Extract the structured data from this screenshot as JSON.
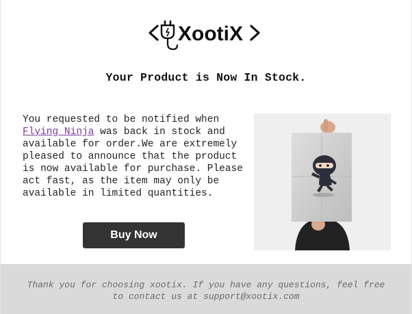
{
  "brand": {
    "name": "XootiX"
  },
  "headline": "Your Product is Now In Stock.",
  "message": {
    "intro": "You requested to be notified when ",
    "product_link": "Flying Ninja",
    "rest": " was back in stock and available for order.We are extremely pleased to announce that the product is now available for purchase. Please act fast, as the item may only be available in limited quantities."
  },
  "cta": {
    "label": "Buy Now"
  },
  "footer": {
    "text": "Thank you for choosing xootix. If you have any questions, feel free to contact us at support@xootix.com"
  },
  "colors": {
    "button_bg": "#333333",
    "link": "#7b3a99",
    "footer_bg": "#dadada"
  },
  "icons": {
    "logo": "plug-icon",
    "product": "ninja-poster-image"
  }
}
